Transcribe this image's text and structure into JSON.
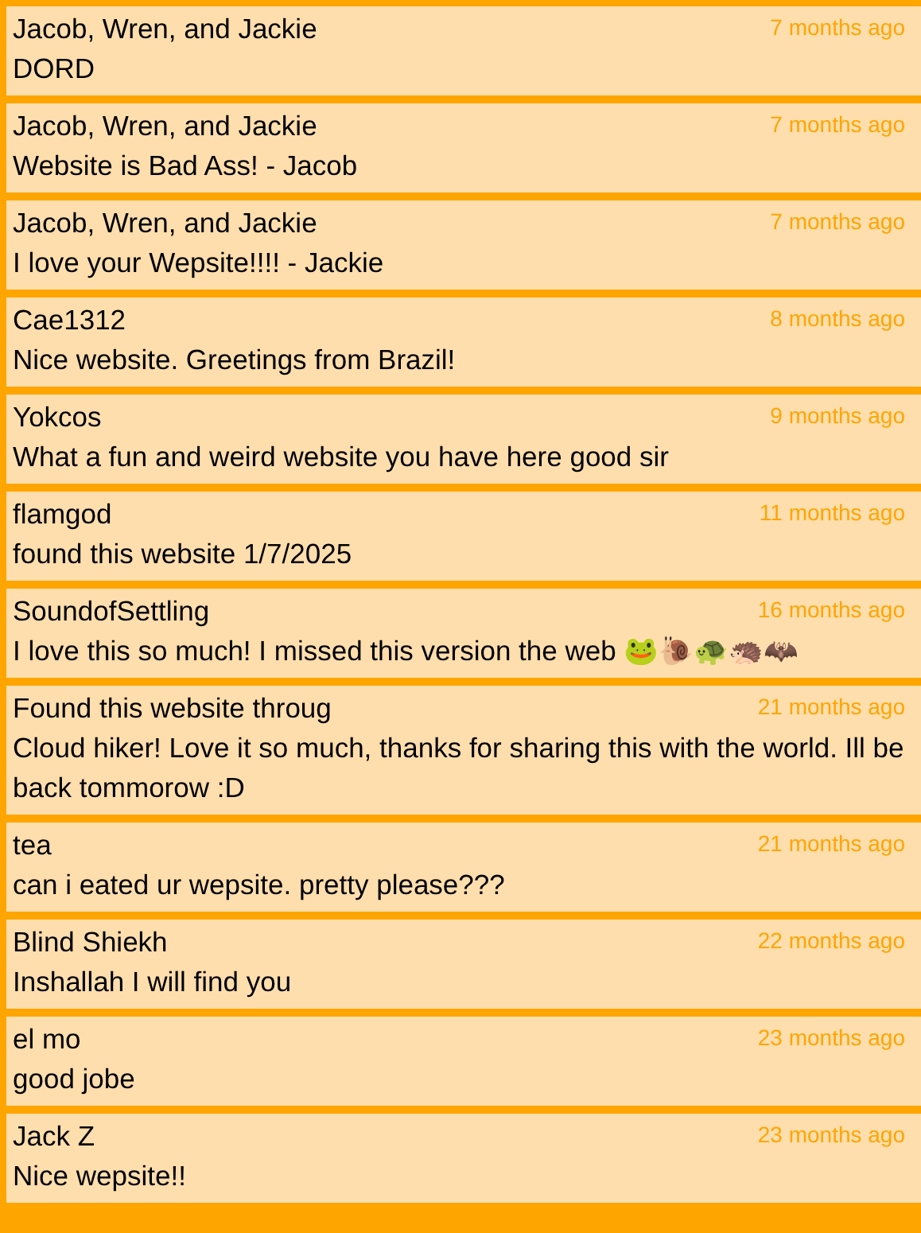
{
  "comments": [
    {
      "author": "Jacob, Wren, and Jackie",
      "time": "7 months ago",
      "message": "DORD"
    },
    {
      "author": "Jacob, Wren, and Jackie",
      "time": "7 months ago",
      "message": "Website is Bad Ass! - Jacob"
    },
    {
      "author": "Jacob, Wren, and Jackie",
      "time": "7 months ago",
      "message": "I love your Wepsite!!!! - Jackie"
    },
    {
      "author": "Cae1312",
      "time": "8 months ago",
      "message": "Nice website. Greetings from Brazil!"
    },
    {
      "author": "Yokcos",
      "time": "9 months ago",
      "message": "What a fun and weird website you have here good sir"
    },
    {
      "author": "flamgod",
      "time": "11 months ago",
      "message": "found this website 1/7/2025"
    },
    {
      "author": "SoundofSettling",
      "time": "16 months ago",
      "message": "I love this so much! I missed this version the web 🐸🐌🐢🦔🦇"
    },
    {
      "author": "Found this website throug",
      "time": "21 months ago",
      "message": "Cloud hiker! Love it so much, thanks for sharing this with the world. Ill be back tommorow :D"
    },
    {
      "author": "tea",
      "time": "21 months ago",
      "message": "can i eated ur wepsite. pretty please???"
    },
    {
      "author": "Blind Shiekh",
      "time": "22 months ago",
      "message": "Inshallah I will find you"
    },
    {
      "author": "el mo",
      "time": "23 months ago",
      "message": "good jobe"
    },
    {
      "author": "Jack Z",
      "time": "23 months ago",
      "message": "Nice wepsite!!"
    }
  ]
}
